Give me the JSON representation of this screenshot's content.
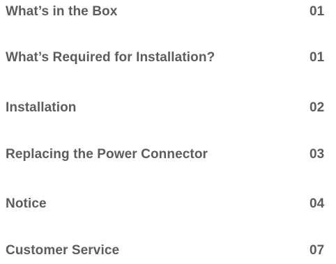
{
  "toc": {
    "entries": [
      {
        "title": "What’s in the Box",
        "page": "01"
      },
      {
        "title": "What’s Required for Installation?",
        "page": "01"
      },
      {
        "title": "Installation",
        "page": "02"
      },
      {
        "title": "Replacing the Power Connector",
        "page": "03"
      },
      {
        "title": "Notice",
        "page": "04"
      },
      {
        "title": "Customer Service",
        "page": "07"
      }
    ]
  }
}
